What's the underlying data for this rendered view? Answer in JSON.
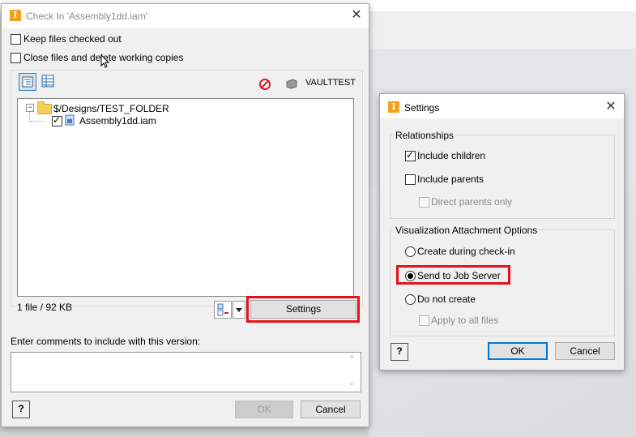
{
  "checkin": {
    "title": "Check In 'Assembly1dd.iam'",
    "keep_checked_out": "Keep files checked out",
    "close_files": "Close files and delete working copies",
    "vault_name": "VAULTTEST",
    "tree_root": "$/Designs/TEST_FOLDER",
    "tree_child": "Assembly1dd.iam",
    "file_count": "1 file / 92 KB",
    "settings_button": "Settings",
    "comments_label": "Enter comments to include with this version:",
    "comments_value": "",
    "ok_button": "OK",
    "cancel_button": "Cancel"
  },
  "settings": {
    "title": "Settings",
    "relationships_title": "Relationships",
    "include_children": "Include children",
    "include_parents": "Include parents",
    "direct_parents_only": "Direct parents only",
    "visualization_title": "Visualization Attachment Options",
    "create_during_checkin": "Create during check-in",
    "send_to_job_server": "Send to Job Server",
    "do_not_create": "Do not create",
    "apply_to_all": "Apply to all files",
    "ok_button": "OK",
    "cancel_button": "Cancel"
  },
  "colors": {
    "highlight": "#e3121c",
    "accent": "#0078d7",
    "app_icon": "#f4a21d"
  },
  "icons": [
    "app-icon",
    "close-icon",
    "help-icon",
    "folder-icon",
    "dropdown-arrow-icon"
  ]
}
